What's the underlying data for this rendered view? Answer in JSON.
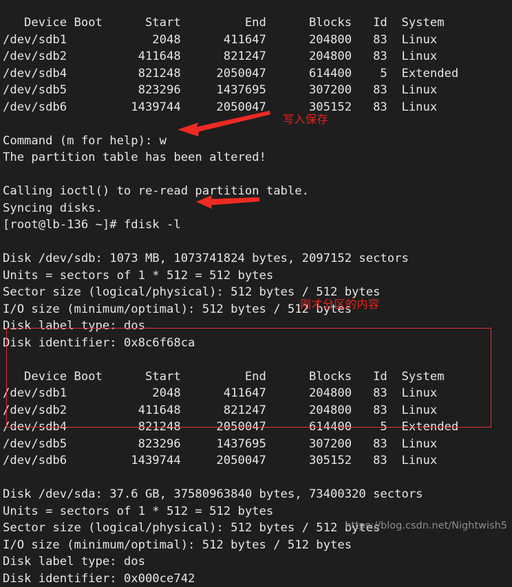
{
  "terminal": {
    "background_color": "#1e1e1e",
    "text_color": "#e6e6e6",
    "accent_color": "#e8201c",
    "watermark": "https://blog.csdn.net/Nightwish5",
    "lines": [
      "   Device Boot      Start         End      Blocks   Id  System",
      "/dev/sdb1            2048      411647      204800   83  Linux",
      "/dev/sdb2          411648      821247      204800   83  Linux",
      "/dev/sdb4          821248     2050047      614400    5  Extended",
      "/dev/sdb5          823296     1437695      307200   83  Linux",
      "/dev/sdb6         1439744     2050047      305152   83  Linux",
      "",
      "Command (m for help): w",
      "The partition table has been altered!",
      "",
      "Calling ioctl() to re-read partition table.",
      "Syncing disks.",
      "[root@lb-136 ~]# fdisk -l",
      "",
      "Disk /dev/sdb: 1073 MB, 1073741824 bytes, 2097152 sectors",
      "Units = sectors of 1 * 512 = 512 bytes",
      "Sector size (logical/physical): 512 bytes / 512 bytes",
      "I/O size (minimum/optimal): 512 bytes / 512 bytes",
      "Disk label type: dos",
      "Disk identifier: 0x8c6f68ca",
      "",
      "   Device Boot      Start         End      Blocks   Id  System",
      "/dev/sdb1            2048      411647      204800   83  Linux",
      "/dev/sdb2          411648      821247      204800   83  Linux",
      "/dev/sdb4          821248     2050047      614400    5  Extended",
      "/dev/sdb5          823296     1437695      307200   83  Linux",
      "/dev/sdb6         1439744     2050047      305152   83  Linux",
      "",
      "Disk /dev/sda: 37.6 GB, 37580963840 bytes, 73400320 sectors",
      "Units = sectors of 1 * 512 = 512 bytes",
      "Sector size (logical/physical): 512 bytes / 512 bytes",
      "I/O size (minimum/optimal): 512 bytes / 512 bytes",
      "Disk label type: dos",
      "Disk identifier: 0x000ce742"
    ]
  },
  "partition_table": {
    "columns": [
      "Device Boot",
      "Start",
      "End",
      "Blocks",
      "Id",
      "System"
    ],
    "rows": [
      [
        "/dev/sdb1",
        "2048",
        "411647",
        "204800",
        "83",
        "Linux"
      ],
      [
        "/dev/sdb2",
        "411648",
        "821247",
        "204800",
        "83",
        "Linux"
      ],
      [
        "/dev/sdb4",
        "821248",
        "2050047",
        "614400",
        "5",
        "Extended"
      ],
      [
        "/dev/sdb5",
        "823296",
        "1437695",
        "307200",
        "83",
        "Linux"
      ],
      [
        "/dev/sdb6",
        "1439744",
        "2050047",
        "305152",
        "83",
        "Linux"
      ]
    ]
  },
  "disks": [
    {
      "device": "/dev/sdb",
      "size_human": "1073 MB",
      "size_bytes": "1073741824 bytes",
      "sectors": "2097152 sectors",
      "units": "Units = sectors of 1 * 512 = 512 bytes",
      "sector_size": "Sector size (logical/physical): 512 bytes / 512 bytes",
      "io_size": "I/O size (minimum/optimal): 512 bytes / 512 bytes",
      "label_type": "Disk label type: dos",
      "identifier": "Disk identifier: 0x8c6f68ca"
    },
    {
      "device": "/dev/sda",
      "size_human": "37.6 GB",
      "size_bytes": "37580963840 bytes",
      "sectors": "73400320 sectors",
      "units": "Units = sectors of 1 * 512 = 512 bytes",
      "sector_size": "Sector size (logical/physical): 512 bytes / 512 bytes",
      "io_size": "I/O size (minimum/optimal): 512 bytes / 512 bytes",
      "label_type": "Disk label type: dos",
      "identifier": "Disk identifier: 0x000ce742"
    }
  ],
  "prompt": {
    "user_host": "[root@lb-136 ~]#",
    "command": "fdisk -l",
    "fdisk_prompt": "Command (m for help):",
    "fdisk_input": "w"
  },
  "annotations": {
    "write_save": "写入保存",
    "partition_content": "刚才分区的内容"
  }
}
